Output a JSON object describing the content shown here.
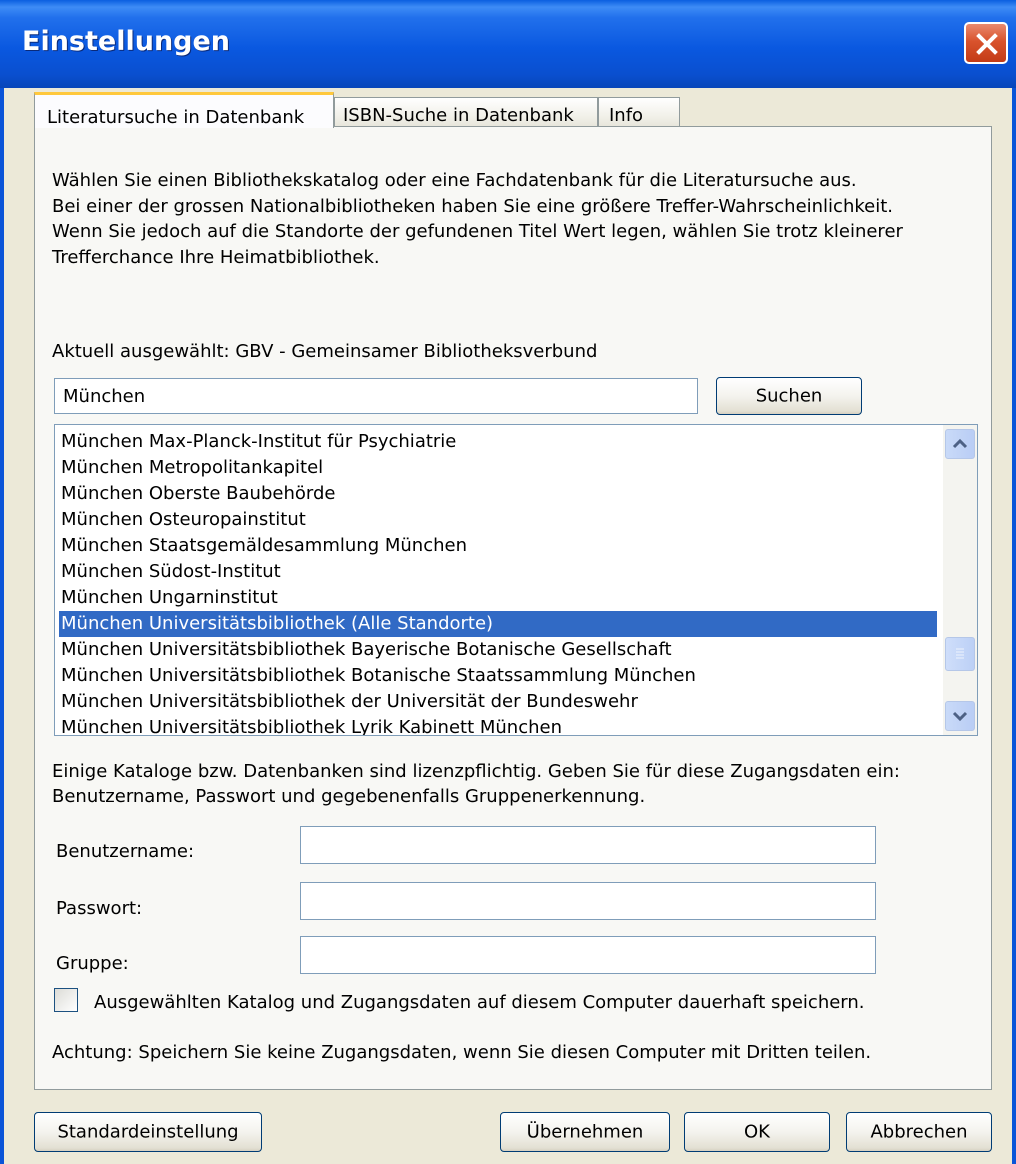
{
  "window": {
    "title": "Einstellungen"
  },
  "tabs": [
    {
      "label": "Literatursuche in Datenbank",
      "active": true
    },
    {
      "label": "ISBN-Suche in Datenbank",
      "active": false
    },
    {
      "label": "Info",
      "active": false
    }
  ],
  "intro": {
    "line1": "Wählen Sie einen Bibliothekskatalog oder eine Fachdatenbank für die Literatursuche aus.",
    "line2": "Bei einer der grossen Nationalbibliotheken haben Sie eine größere Treffer-Wahrscheinlichkeit.",
    "line3": "Wenn Sie jedoch auf die Standorte der gefundenen Titel Wert legen, wählen Sie trotz kleinerer",
    "line4": "Trefferchance Ihre Heimatbibliothek."
  },
  "selection": {
    "current_label": "Aktuell ausgewählt: GBV - Gemeinsamer Bibliotheksverbund"
  },
  "search": {
    "value": "München",
    "button_label": "Suchen"
  },
  "library_list": {
    "items": [
      "München Max-Planck-Institut für Psychiatrie",
      "München Metropolitankapitel",
      "München Oberste Baubehörde",
      "München Osteuropainstitut",
      "München Staatsgemäldesammlung München",
      "München Südost-Institut",
      "München Ungarninstitut",
      "München Universitätsbibliothek (Alle Standorte)",
      "München Universitätsbibliothek Bayerische Botanische Gesellschaft",
      "München Universitätsbibliothek Botanische Staatssammlung München",
      "München Universitätsbibliothek der Universität der Bundeswehr",
      "München Universitätsbibliothek Lyrik Kabinett München"
    ],
    "selected_index": 7,
    "selection_color": "#316ac5"
  },
  "license": {
    "line1": "Einige Kataloge bzw. Datenbanken sind lizenzpflichtig. Geben Sie für diese Zugangsdaten ein:",
    "line2": "Benutzername, Passwort und gegebenenfalls Gruppenerkennung."
  },
  "credentials": {
    "username_label": "Benutzername:",
    "username_value": "",
    "password_label": "Passwort:",
    "password_value": "",
    "group_label": "Gruppe:",
    "group_value": ""
  },
  "save_option": {
    "checked": false,
    "label": "Ausgewählten Katalog und Zugangsdaten auf diesem Computer dauerhaft speichern."
  },
  "warning": "Achtung: Speichern Sie keine Zugangsdaten, wenn Sie diesen Computer mit Dritten teilen.",
  "footer": {
    "default_label": "Standardeinstellung",
    "apply_label": "Übernehmen",
    "ok_label": "OK",
    "cancel_label": "Abbrechen"
  },
  "colors": {
    "title_bar": "#0a58e0",
    "dialog_bg": "#ece9d8",
    "close_button": "#d9532d"
  }
}
